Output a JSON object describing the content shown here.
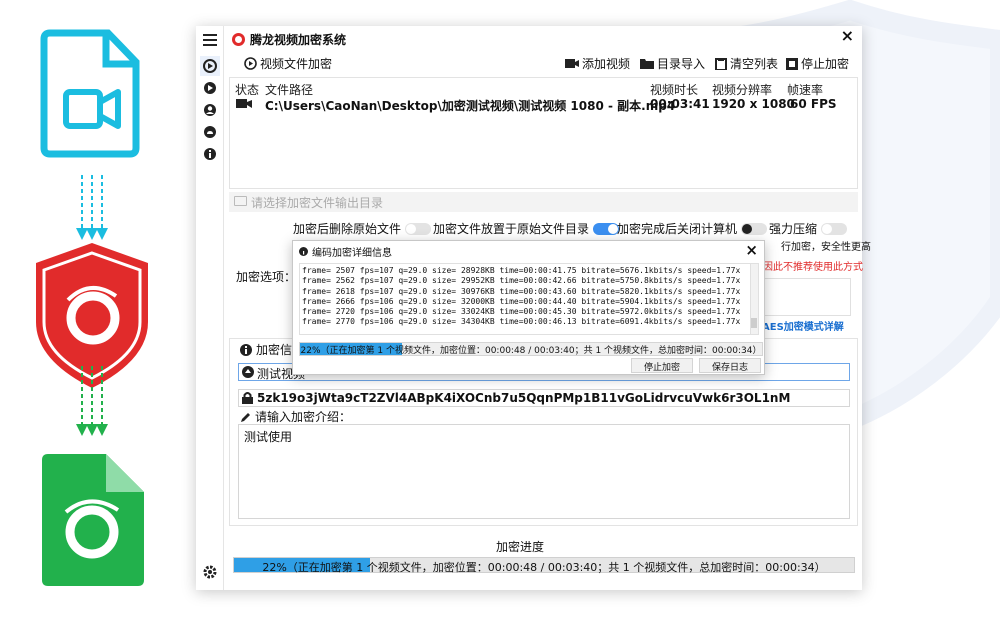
{
  "app": {
    "title": "腾龙视频加密系统"
  },
  "toolbar": {
    "section": "视频文件加密",
    "add_video": "添加视频",
    "import_dir": "目录导入",
    "clear_list": "清空列表",
    "stop": "停止加密"
  },
  "table": {
    "headers": [
      "状态",
      "文件路径",
      "视频时长",
      "视频分辨率",
      "帧速率"
    ],
    "rows": [
      {
        "path": "C:\\Users\\CaoNan\\Desktop\\加密测试视频\\测试视频 1080 - 副本.mp4",
        "duration": "00:03:41",
        "resolution": "1920 x 1080",
        "fps": "60 FPS"
      }
    ]
  },
  "output_dir": {
    "placeholder": "请选择加密文件输出目录"
  },
  "options": {
    "delete_source": "加密后删除原始文件",
    "same_dir": "加密文件放置于原始文件目录",
    "shutdown": "加密完成后关闭计算机",
    "compress": "强力压缩",
    "label": "加密选项：",
    "partial1": "行加密，安全性更高",
    "partial2": "因此不推荐使用此方式",
    "aes_link": "AES加密模式详解"
  },
  "info": {
    "tab_label": "加密信",
    "title_field": "测试视频",
    "password": "5zk19o3jWta9cT2ZVl4ABpK4iXOCnb7u5QqnPMp1B11vGoLidrvcuVwk6r3OL1nM",
    "intro_label": "请输入加密介绍：",
    "intro_text": "测试使用"
  },
  "progress": {
    "label": "加密进度",
    "percent": 22,
    "text": "22%（正在加密第 1 个视频文件，加密位置：00:00:48 / 00:03:40；共 1 个视频文件，总加密时间：00:00:34）"
  },
  "dialog": {
    "title": "编码加密详细信息",
    "log": [
      "frame= 2507 fps=107 q=29.0 size=    28928KB time=00:00:41.75 bitrate=5676.1kbits/s speed=1.77x",
      "frame= 2562 fps=107 q=29.0 size=    29952KB time=00:00:42.66 bitrate=5750.8kbits/s speed=1.77x",
      "frame= 2618 fps=107 q=29.0 size=    30976KB time=00:00:43.60 bitrate=5820.1kbits/s speed=1.77x",
      "frame= 2666 fps=106 q=29.0 size=    32000KB time=00:00:44.40 bitrate=5904.1kbits/s speed=1.77x",
      "frame= 2720 fps=106 q=29.0 size=    33024KB time=00:00:45.30 bitrate=5972.0kbits/s speed=1.77x",
      "frame= 2770 fps=106 q=29.0 size=    34304KB time=00:00:46.13 bitrate=6091.4kbits/s speed=1.77x"
    ],
    "progress_percent": 22,
    "progress_text": "22%（正在加密第 1 个视频文件，加密位置：00:00:48 / 00:03:40；共 1 个视频文件，总加密时间：00:00:34）",
    "stop_btn": "停止加密",
    "save_log_btn": "保存日志"
  },
  "colors": {
    "accent": "#2f9fe6",
    "brand_red": "#e12b2b",
    "video_blue": "#1bbde0",
    "doc_green": "#22b14c"
  }
}
